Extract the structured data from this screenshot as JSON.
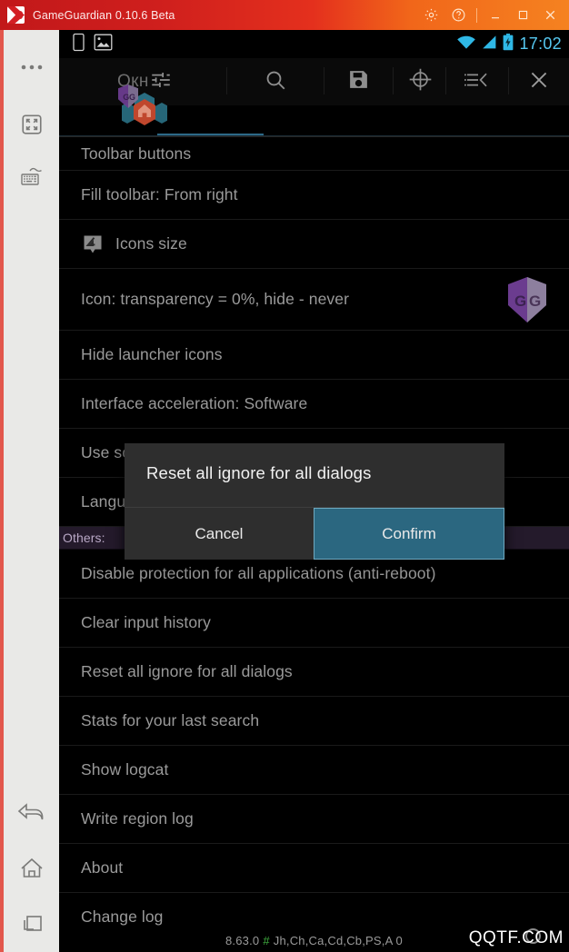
{
  "window": {
    "title": "GameGuardian 0.10.6 Beta",
    "app_icon": "gameguardian-logo-icon",
    "controls": [
      {
        "name": "settings-gear-button",
        "icon": "gear-icon"
      },
      {
        "name": "help-button",
        "icon": "question-circle-icon"
      },
      {
        "name": "minimize-button",
        "icon": "minimize-icon"
      },
      {
        "name": "maximize-button",
        "icon": "maximize-icon"
      },
      {
        "name": "close-button",
        "icon": "close-icon"
      }
    ]
  },
  "rail": {
    "items": [
      {
        "name": "more-options-button",
        "icon": "three-dots-icon"
      },
      {
        "name": "fullscreen-button",
        "icon": "fullscreen-expand-icon"
      },
      {
        "name": "keyboard-macro-button",
        "icon": "keyboard-script-icon"
      },
      {
        "name": "back-button",
        "icon": "back-arrow-icon"
      },
      {
        "name": "home-button",
        "icon": "home-icon"
      },
      {
        "name": "recents-button",
        "icon": "recent-apps-icon"
      }
    ]
  },
  "statusbar": {
    "icons": [
      "sim-card-icon",
      "screenshot-icon",
      "wifi-icon",
      "signal-icon",
      "battery-icon"
    ],
    "clock": "17:02"
  },
  "toolbar": {
    "home_label": "Окн",
    "tabs": [
      {
        "name": "tab-home",
        "icon": "home-icon",
        "label": "Окн"
      },
      {
        "name": "tab-sliders",
        "icon": "sliders-icon"
      },
      {
        "name": "tab-search",
        "icon": "search-icon"
      },
      {
        "name": "tab-save",
        "icon": "floppy-save-icon"
      },
      {
        "name": "tab-crosshair",
        "icon": "crosshair-target-icon"
      },
      {
        "name": "tab-list",
        "icon": "list-icon"
      },
      {
        "name": "tab-close",
        "icon": "close-icon"
      }
    ],
    "active_tab_index": 0,
    "accent_color": "#2f6f8f"
  },
  "settings_list": {
    "rows": [
      {
        "name": "row-toolbar-buttons",
        "label": "Toolbar buttons",
        "icon": null,
        "right_icon": null,
        "height": "h38"
      },
      {
        "name": "row-fill-toolbar",
        "label": "Fill toolbar: From right",
        "icon": null,
        "right_icon": null,
        "height": "h54"
      },
      {
        "name": "row-icons-size",
        "label": "Icons size",
        "icon": "icon-size-bubble-icon",
        "right_icon": null,
        "height": "h54"
      },
      {
        "name": "row-icon-transparency",
        "label": "Icon: transparency = 0%, hide - never",
        "icon": null,
        "right_icon": "gg-shield-logo-icon",
        "height": "h68"
      },
      {
        "name": "row-hide-launcher-icons",
        "label": "Hide launcher icons",
        "icon": null,
        "right_icon": null,
        "height": "h54"
      },
      {
        "name": "row-interface-acceleration",
        "label": "Interface acceleration: Software",
        "icon": null,
        "right_icon": null,
        "height": "h54"
      },
      {
        "name": "row-use-sound-effects",
        "label": "Use sound effects: Yes",
        "icon": null,
        "right_icon": null,
        "height": "h54"
      },
      {
        "name": "row-language",
        "label": "Language: English",
        "icon": null,
        "right_icon": null,
        "height": "h54"
      }
    ],
    "section_header": "Others:",
    "rows_after": [
      {
        "name": "row-disable-protection",
        "label": "Disable protection for all applications (anti-reboot)",
        "icon": null,
        "right_icon": null,
        "height": "h54"
      },
      {
        "name": "row-clear-input-history",
        "label": "Clear input history",
        "icon": null,
        "right_icon": null,
        "height": "h54"
      },
      {
        "name": "row-reset-all-ignore",
        "label": "Reset all ignore for all dialogs",
        "icon": null,
        "right_icon": null,
        "height": "h54"
      },
      {
        "name": "row-stats-last-search",
        "label": "Stats for your last search",
        "icon": null,
        "right_icon": null,
        "height": "h54"
      },
      {
        "name": "row-show-logcat",
        "label": "Show logcat",
        "icon": null,
        "right_icon": null,
        "height": "h54"
      },
      {
        "name": "row-write-region-log",
        "label": "Write region log",
        "icon": null,
        "right_icon": null,
        "height": "h54"
      },
      {
        "name": "row-about",
        "label": "About",
        "icon": null,
        "right_icon": null,
        "height": "h54"
      },
      {
        "name": "row-change-log",
        "label": "Change log",
        "icon": null,
        "right_icon": null,
        "height": "h54"
      }
    ]
  },
  "dialog": {
    "title": "Reset all ignore for all dialogs",
    "cancel_label": "Cancel",
    "confirm_label": "Confirm",
    "confirm_color": "#2b6780"
  },
  "footer": {
    "version": "8.63.0",
    "hash": "#",
    "flags": "Jh,Ch,Ca,Cd,Cb,PS,A 0"
  },
  "watermark": "QQTF.COM"
}
